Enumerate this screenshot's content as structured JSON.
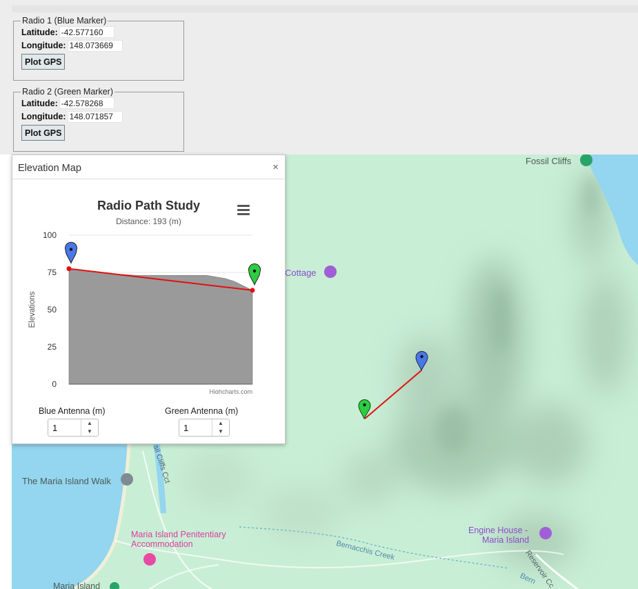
{
  "radio1": {
    "legend": "Radio 1 (Blue Marker)",
    "latitude_label": "Latitude:",
    "latitude_value": "-42.577160",
    "longitude_label": "Longitude:",
    "longitude_value": "148.073669",
    "button_label": "Plot GPS"
  },
  "radio2": {
    "legend": "Radio 2 (Green Marker)",
    "latitude_label": "Latitude:",
    "latitude_value": "-42.578268",
    "longitude_label": "Longitude:",
    "longitude_value": "148.071857",
    "button_label": "Plot GPS"
  },
  "dialog": {
    "title": "Elevation Map",
    "close_glyph": "×",
    "blue_antenna_label": "Blue Antenna (m)",
    "blue_antenna_value": "1",
    "green_antenna_label": "Green Antenna (m)",
    "green_antenna_value": "1",
    "menu_icon": "hamburger-menu-icon"
  },
  "chart_data": {
    "type": "area",
    "title": "Radio Path Study",
    "subtitle": "Distance: 193 (m)",
    "ylabel": "Elevations",
    "xlabel": "",
    "ylim": [
      0,
      100
    ],
    "yticks": [
      "100",
      "75",
      "50",
      "25",
      "0"
    ],
    "credits": "Highcharts.com",
    "terrain": {
      "x": [
        0,
        12,
        25,
        37,
        50,
        62,
        75,
        80,
        85,
        90,
        95,
        100
      ],
      "y": [
        77,
        76,
        74,
        73,
        73,
        73,
        73,
        72,
        71,
        69,
        66,
        63
      ]
    },
    "path_line": {
      "x": [
        0,
        100
      ],
      "y": [
        77.5,
        63
      ]
    },
    "blue_marker_elevation": 77.5,
    "green_marker_elevation": 63,
    "colors": {
      "terrain": "#9a9a9a",
      "path": "#e01010",
      "blue": "#4a77e6",
      "green": "#2ecc40"
    }
  },
  "map": {
    "labels": {
      "fossil_cliffs": "Fossil Cliffs",
      "cottage": "Cottage",
      "maria_island_walk": "The Maria Island Walk",
      "penitentiary_line1": "Maria Island Penitentiary",
      "penitentiary_line2": "Accommodation",
      "engine_house_line1": "Engine House -",
      "engine_house_line2": "Maria Island",
      "bernacchis_creek": "Bernacchis Creek",
      "fossil_cliffs_cct": "sil Cliffs Cct",
      "reservoir": "Reservoir Cc",
      "bern": "Bern",
      "maria_island_bottom": "Maria Island"
    },
    "colors": {
      "land": "#c9eed6",
      "water": "#94d5ef",
      "hills": "#a9c9b2",
      "road": "#ffffff",
      "poi_purple": "#a05fd6",
      "poi_pink": "#e84aa3",
      "poi_gray": "#7e8b93",
      "poi_green": "#29a36a"
    }
  }
}
